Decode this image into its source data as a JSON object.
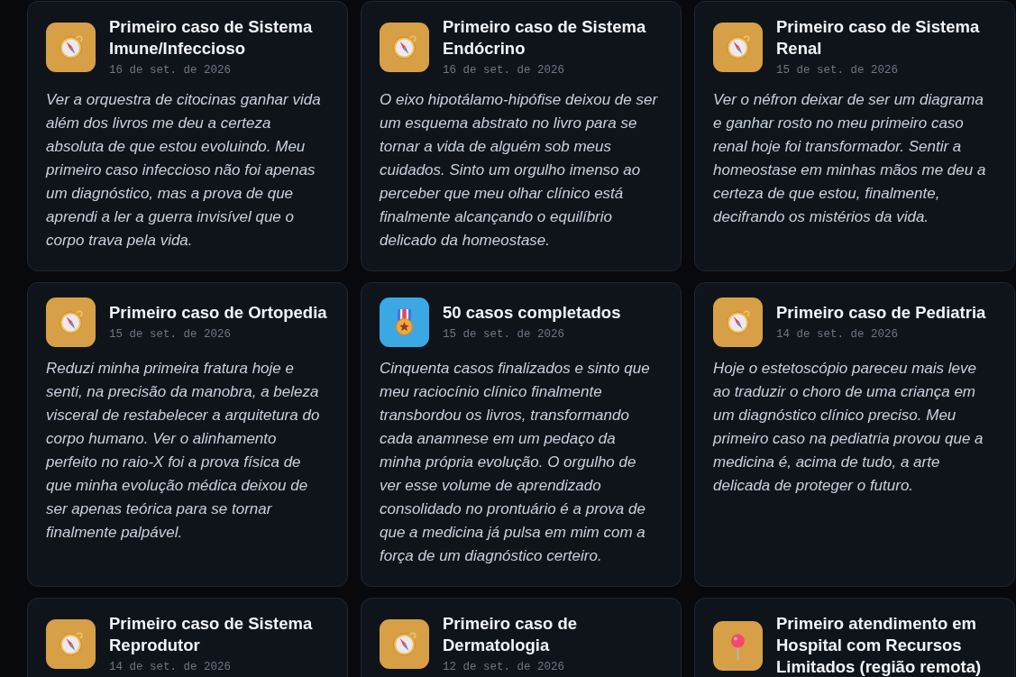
{
  "entries": [
    {
      "kind": "compass",
      "title": "Primeiro caso de Sistema Imune/Infeccioso",
      "date": "16 de set. de 2026",
      "text": "Ver a orquestra de citocinas ganhar vida além dos livros me deu a certeza absoluta de que estou evoluindo. Meu primeiro caso infeccioso não foi apenas um diagnóstico, mas a prova de que aprendi a ler a guerra invisível que o corpo trava pela vida."
    },
    {
      "kind": "compass",
      "title": "Primeiro caso de Sistema Endócrino",
      "date": "16 de set. de 2026",
      "text": "O eixo hipotálamo-hipófise deixou de ser um esquema abstrato no livro para se tornar a vida de alguém sob meus cuidados. Sinto um orgulho imenso ao perceber que meu olhar clínico está finalmente alcançando o equilíbrio delicado da homeostase."
    },
    {
      "kind": "compass",
      "title": "Primeiro caso de Sistema Renal",
      "date": "15 de set. de 2026",
      "text": "Ver o néfron deixar de ser um diagrama e ganhar rosto no meu primeiro caso renal hoje foi transformador. Sentir a homeostase em minhas mãos me deu a certeza de que estou, finalmente, decifrando os mistérios da vida."
    },
    {
      "kind": "compass",
      "title": "Primeiro caso de Ortopedia",
      "date": "15 de set. de 2026",
      "text": "Reduzi minha primeira fratura hoje e senti, na precisão da manobra, a beleza visceral de restabelecer a arquitetura do corpo humano. Ver o alinhamento perfeito no raio-X foi a prova física de que minha evolução médica deixou de ser apenas teórica para se tornar finalmente palpável."
    },
    {
      "kind": "medal",
      "title": "50 casos completados",
      "date": "15 de set. de 2026",
      "text": "Cinquenta casos finalizados e sinto que meu raciocínio clínico finalmente transbordou os livros, transformando cada anamnese em um pedaço da minha própria evolução. O orgulho de ver esse volume de aprendizado consolidado no prontuário é a prova de que a medicina já pulsa em mim com a força de um diagnóstico certeiro."
    },
    {
      "kind": "compass",
      "title": "Primeiro caso de Pediatria",
      "date": "14 de set. de 2026",
      "text": "Hoje o estetoscópio pareceu mais leve ao traduzir o choro de uma criança em um diagnóstico clínico preciso. Meu primeiro caso na pediatria provou que a medicina é, acima de tudo, a arte delicada de proteger o futuro."
    },
    {
      "kind": "compass",
      "title": "Primeiro caso de Sistema Reprodutor",
      "date": "14 de set. de 2026"
    },
    {
      "kind": "compass",
      "title": "Primeiro caso de Dermatologia",
      "date": "12 de set. de 2026"
    },
    {
      "kind": "pin",
      "title": "Primeiro atendimento em Hospital com Recursos Limitados (região remota)"
    }
  ]
}
